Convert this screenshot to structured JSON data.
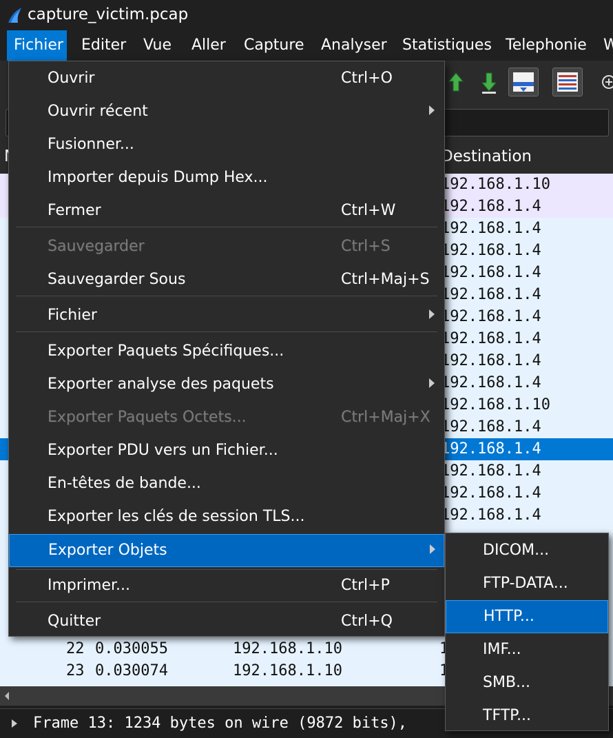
{
  "window": {
    "title": "capture_victim.pcap"
  },
  "menubar": {
    "items": [
      "Fichier",
      "Editer",
      "Vue",
      "Aller",
      "Capture",
      "Analyser",
      "Statistiques",
      "Telephonie",
      "W"
    ]
  },
  "packet_list": {
    "headers": {
      "no": "N",
      "destination": "Destination"
    },
    "destinations": [
      "192.168.1.10",
      "192.168.1.4",
      "192.168.1.4",
      "192.168.1.4",
      "192.168.1.4",
      "192.168.1.4",
      "192.168.1.4",
      "192.168.1.4",
      "192.168.1.4",
      "192.168.1.4",
      "192.168.1.10",
      "192.168.1.4",
      "192.168.1.4",
      "192.168.1.4",
      "192.168.1.4",
      "192.168.1.4"
    ],
    "bottom_rows": [
      {
        "no": "22",
        "time": "0.030055",
        "source": "192.168.1.10",
        "dest": "1"
      },
      {
        "no": "23",
        "time": "0.030074",
        "source": "192.168.1.10",
        "dest": "1"
      }
    ]
  },
  "detail": {
    "text": "Frame 13: 1234 bytes on wire (9872 bits),"
  },
  "file_menu": {
    "items": [
      {
        "label": "Ouvrir",
        "shortcut": "Ctrl+O"
      },
      {
        "label": "Ouvrir récent",
        "submenu": true
      },
      {
        "label": "Fusionner..."
      },
      {
        "label": "Importer depuis Dump Hex..."
      },
      {
        "label": "Fermer",
        "shortcut": "Ctrl+W"
      },
      {
        "label": "Sauvegarder",
        "shortcut": "Ctrl+S",
        "disabled": true
      },
      {
        "label": "Sauvegarder Sous",
        "shortcut": "Ctrl+Maj+S"
      },
      {
        "label": "Fichier",
        "submenu": true
      },
      {
        "label": "Exporter Paquets Spécifiques..."
      },
      {
        "label": "Exporter analyse des paquets",
        "submenu": true
      },
      {
        "label": "Exporter Paquets Octets...",
        "shortcut": "Ctrl+Maj+X",
        "disabled": true
      },
      {
        "label": "Exporter PDU vers un Fichier..."
      },
      {
        "label": "En-têtes de bande..."
      },
      {
        "label": "Exporter les clés de session TLS..."
      },
      {
        "label": "Exporter Objets",
        "submenu": true,
        "highlighted": true
      },
      {
        "label": "Imprimer...",
        "shortcut": "Ctrl+P"
      },
      {
        "label": "Quitter",
        "shortcut": "Ctrl+Q"
      }
    ]
  },
  "export_objects_menu": {
    "items": [
      "DICOM...",
      "FTP-DATA...",
      "HTTP...",
      "IMF...",
      "SMB...",
      "TFTP..."
    ],
    "highlighted": "HTTP..."
  },
  "colors": {
    "accent": "#0078d4",
    "menu_bg": "#2b2b2b",
    "row_bg": "#e6f3ff",
    "selected_row": "#0078d4"
  }
}
